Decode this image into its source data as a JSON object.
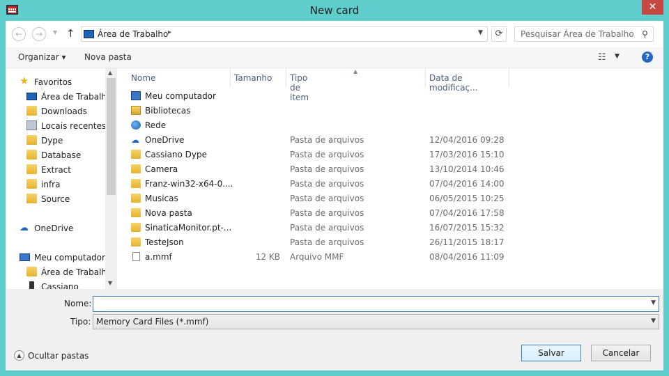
{
  "window": {
    "title": "New card",
    "close_label": "✕"
  },
  "address": {
    "location": "Área de Trabalho",
    "separator": "▸"
  },
  "search": {
    "placeholder": "Pesquisar Área de Trabalho"
  },
  "toolbar": {
    "organize_label": "Organizar ▾",
    "new_folder_label": "Nova pasta",
    "help_label": "?"
  },
  "sidebar": {
    "favorites": "Favoritos",
    "items": [
      {
        "label": "Área de Trabalho",
        "icon": "desktop-icon"
      },
      {
        "label": "Downloads",
        "icon": "downloads-folder-icon"
      },
      {
        "label": "Locais recentes",
        "icon": "recent-places-icon"
      },
      {
        "label": "Dype",
        "icon": "folder-icon"
      },
      {
        "label": "Database",
        "icon": "folder-icon"
      },
      {
        "label": "Extract",
        "icon": "folder-icon"
      },
      {
        "label": "infra",
        "icon": "folder-icon"
      },
      {
        "label": "Source",
        "icon": "folder-icon"
      }
    ],
    "onedrive": "OneDrive",
    "computer": "Meu computador",
    "computer_items": [
      {
        "label": "Área de Trabalho",
        "icon": "folder-icon"
      },
      {
        "label": "Cassiano",
        "icon": "phone-icon"
      }
    ]
  },
  "columns": {
    "name": "Nome",
    "size": "Tamanho",
    "type": "Tipo de item",
    "date": "Data de modificaç..."
  },
  "files": [
    {
      "name": "Meu computador",
      "size": "",
      "type": "",
      "date": "",
      "icon": "computer-icon"
    },
    {
      "name": "Bibliotecas",
      "size": "",
      "type": "",
      "date": "",
      "icon": "libraries-icon"
    },
    {
      "name": "Rede",
      "size": "",
      "type": "",
      "date": "",
      "icon": "network-icon"
    },
    {
      "name": "OneDrive",
      "size": "",
      "type": "Pasta de arquivos",
      "date": "12/04/2016 09:28",
      "icon": "onedrive-icon"
    },
    {
      "name": "Cassiano Dype",
      "size": "",
      "type": "Pasta de arquivos",
      "date": "17/03/2016 15:10",
      "icon": "user-folder-icon"
    },
    {
      "name": "Camera",
      "size": "",
      "type": "Pasta de arquivos",
      "date": "13/10/2014 10:46",
      "icon": "folder-icon"
    },
    {
      "name": "Franz-win32-x64-0....",
      "size": "",
      "type": "Pasta de arquivos",
      "date": "07/04/2016 14:00",
      "icon": "folder-icon"
    },
    {
      "name": "Musicas",
      "size": "",
      "type": "Pasta de arquivos",
      "date": "06/05/2015 10:25",
      "icon": "folder-icon"
    },
    {
      "name": "Nova pasta",
      "size": "",
      "type": "Pasta de arquivos",
      "date": "07/04/2016 17:58",
      "icon": "folder-icon"
    },
    {
      "name": "SinaticaMonitor.pt-...",
      "size": "",
      "type": "Pasta de arquivos",
      "date": "16/07/2015 15:32",
      "icon": "folder-icon"
    },
    {
      "name": "TesteJson",
      "size": "",
      "type": "Pasta de arquivos",
      "date": "26/11/2015 18:17",
      "icon": "folder-icon"
    },
    {
      "name": "a.mmf",
      "size": "12 KB",
      "type": "Arquivo MMF",
      "date": "08/04/2016 11:09",
      "icon": "file-icon"
    }
  ],
  "form": {
    "name_label": "Nome:",
    "name_value": "",
    "type_label": "Tipo:",
    "type_value": "Memory Card Files (*.mmf)",
    "hide_folders_label": "Ocultar pastas",
    "save_label": "Salvar",
    "cancel_label": "Cancelar"
  },
  "colors": {
    "window_frame": "#5ecdcb",
    "close_button": "#c74843",
    "accent": "#3c7fb1"
  }
}
